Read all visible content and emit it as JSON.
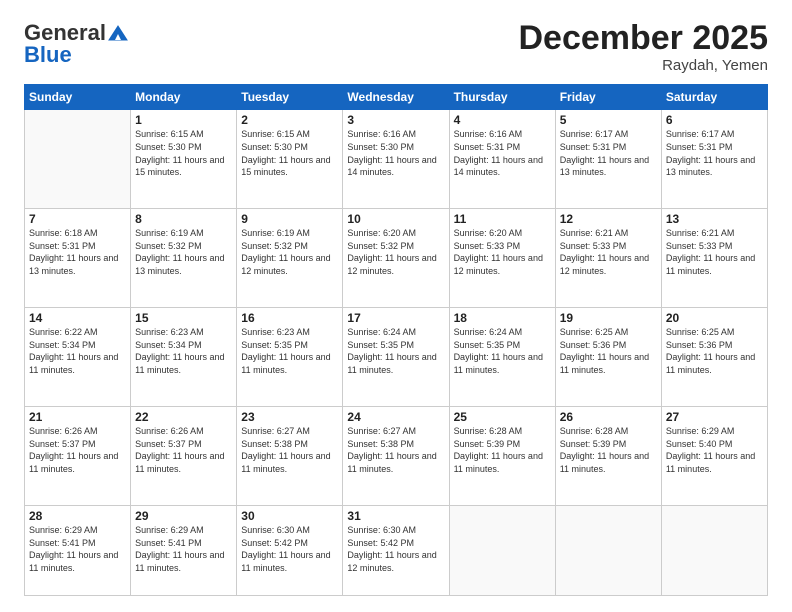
{
  "header": {
    "logo_general": "General",
    "logo_blue": "Blue",
    "month_title": "December 2025",
    "location": "Raydah, Yemen"
  },
  "days_of_week": [
    "Sunday",
    "Monday",
    "Tuesday",
    "Wednesday",
    "Thursday",
    "Friday",
    "Saturday"
  ],
  "weeks": [
    [
      {
        "num": "",
        "empty": true
      },
      {
        "num": "1",
        "sunrise": "6:15 AM",
        "sunset": "5:30 PM",
        "daylight": "11 hours and 15 minutes."
      },
      {
        "num": "2",
        "sunrise": "6:15 AM",
        "sunset": "5:30 PM",
        "daylight": "11 hours and 15 minutes."
      },
      {
        "num": "3",
        "sunrise": "6:16 AM",
        "sunset": "5:30 PM",
        "daylight": "11 hours and 14 minutes."
      },
      {
        "num": "4",
        "sunrise": "6:16 AM",
        "sunset": "5:31 PM",
        "daylight": "11 hours and 14 minutes."
      },
      {
        "num": "5",
        "sunrise": "6:17 AM",
        "sunset": "5:31 PM",
        "daylight": "11 hours and 13 minutes."
      },
      {
        "num": "6",
        "sunrise": "6:17 AM",
        "sunset": "5:31 PM",
        "daylight": "11 hours and 13 minutes."
      }
    ],
    [
      {
        "num": "7",
        "sunrise": "6:18 AM",
        "sunset": "5:31 PM",
        "daylight": "11 hours and 13 minutes."
      },
      {
        "num": "8",
        "sunrise": "6:19 AM",
        "sunset": "5:32 PM",
        "daylight": "11 hours and 13 minutes."
      },
      {
        "num": "9",
        "sunrise": "6:19 AM",
        "sunset": "5:32 PM",
        "daylight": "11 hours and 12 minutes."
      },
      {
        "num": "10",
        "sunrise": "6:20 AM",
        "sunset": "5:32 PM",
        "daylight": "11 hours and 12 minutes."
      },
      {
        "num": "11",
        "sunrise": "6:20 AM",
        "sunset": "5:33 PM",
        "daylight": "11 hours and 12 minutes."
      },
      {
        "num": "12",
        "sunrise": "6:21 AM",
        "sunset": "5:33 PM",
        "daylight": "11 hours and 12 minutes."
      },
      {
        "num": "13",
        "sunrise": "6:21 AM",
        "sunset": "5:33 PM",
        "daylight": "11 hours and 11 minutes."
      }
    ],
    [
      {
        "num": "14",
        "sunrise": "6:22 AM",
        "sunset": "5:34 PM",
        "daylight": "11 hours and 11 minutes."
      },
      {
        "num": "15",
        "sunrise": "6:23 AM",
        "sunset": "5:34 PM",
        "daylight": "11 hours and 11 minutes."
      },
      {
        "num": "16",
        "sunrise": "6:23 AM",
        "sunset": "5:35 PM",
        "daylight": "11 hours and 11 minutes."
      },
      {
        "num": "17",
        "sunrise": "6:24 AM",
        "sunset": "5:35 PM",
        "daylight": "11 hours and 11 minutes."
      },
      {
        "num": "18",
        "sunrise": "6:24 AM",
        "sunset": "5:35 PM",
        "daylight": "11 hours and 11 minutes."
      },
      {
        "num": "19",
        "sunrise": "6:25 AM",
        "sunset": "5:36 PM",
        "daylight": "11 hours and 11 minutes."
      },
      {
        "num": "20",
        "sunrise": "6:25 AM",
        "sunset": "5:36 PM",
        "daylight": "11 hours and 11 minutes."
      }
    ],
    [
      {
        "num": "21",
        "sunrise": "6:26 AM",
        "sunset": "5:37 PM",
        "daylight": "11 hours and 11 minutes."
      },
      {
        "num": "22",
        "sunrise": "6:26 AM",
        "sunset": "5:37 PM",
        "daylight": "11 hours and 11 minutes."
      },
      {
        "num": "23",
        "sunrise": "6:27 AM",
        "sunset": "5:38 PM",
        "daylight": "11 hours and 11 minutes."
      },
      {
        "num": "24",
        "sunrise": "6:27 AM",
        "sunset": "5:38 PM",
        "daylight": "11 hours and 11 minutes."
      },
      {
        "num": "25",
        "sunrise": "6:28 AM",
        "sunset": "5:39 PM",
        "daylight": "11 hours and 11 minutes."
      },
      {
        "num": "26",
        "sunrise": "6:28 AM",
        "sunset": "5:39 PM",
        "daylight": "11 hours and 11 minutes."
      },
      {
        "num": "27",
        "sunrise": "6:29 AM",
        "sunset": "5:40 PM",
        "daylight": "11 hours and 11 minutes."
      }
    ],
    [
      {
        "num": "28",
        "sunrise": "6:29 AM",
        "sunset": "5:41 PM",
        "daylight": "11 hours and 11 minutes."
      },
      {
        "num": "29",
        "sunrise": "6:29 AM",
        "sunset": "5:41 PM",
        "daylight": "11 hours and 11 minutes."
      },
      {
        "num": "30",
        "sunrise": "6:30 AM",
        "sunset": "5:42 PM",
        "daylight": "11 hours and 11 minutes."
      },
      {
        "num": "31",
        "sunrise": "6:30 AM",
        "sunset": "5:42 PM",
        "daylight": "11 hours and 12 minutes."
      },
      {
        "num": "",
        "empty": true
      },
      {
        "num": "",
        "empty": true
      },
      {
        "num": "",
        "empty": true
      }
    ]
  ]
}
